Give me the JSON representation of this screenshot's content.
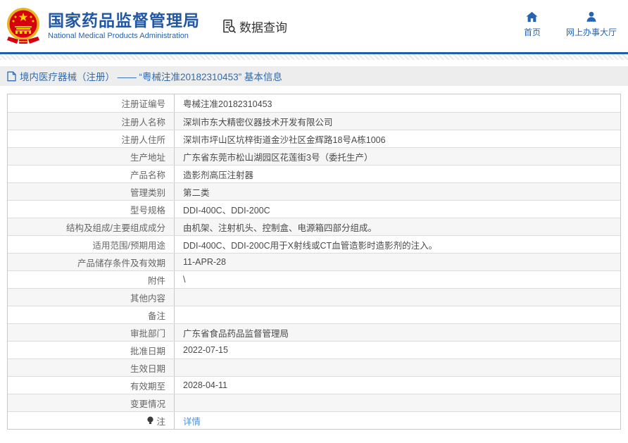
{
  "header": {
    "brand_title": "国家药品监督管理局",
    "brand_subtitle": "National Medical Products Administration",
    "data_query_label": "数据查询",
    "nav": [
      {
        "label": "首页",
        "icon": "home-icon"
      },
      {
        "label": "网上办事大厅",
        "icon": "person-icon"
      }
    ]
  },
  "page": {
    "title": "境内医疗器械（注册） —— “粤械注准20182310453” 基本信息"
  },
  "icons": {
    "emblem": "national-emblem-logo",
    "data_query": "document-search-icon",
    "page_title": "document-icon",
    "note": "bulb-icon"
  },
  "colors": {
    "brand_blue": "#2257a6",
    "nav_blue": "#2464b4",
    "divider_blue": "#1f60aa",
    "title_bar_bg": "#ededed",
    "link_blue": "#4a90d9",
    "zebra_gray": "#f6f6f6"
  },
  "table": {
    "rows": [
      {
        "label": "注册证编号",
        "value": "粤械注准20182310453"
      },
      {
        "label": "注册人名称",
        "value": "深圳市东大精密仪器技术开发有限公司"
      },
      {
        "label": "注册人住所",
        "value": "深圳市坪山区坑梓街道金沙社区金辉路18号A栋1006"
      },
      {
        "label": "生产地址",
        "value": "广东省东莞市松山湖园区花莲街3号（委托生产）"
      },
      {
        "label": "产品名称",
        "value": "造影剂高压注射器"
      },
      {
        "label": "管理类别",
        "value": "第二类"
      },
      {
        "label": "型号规格",
        "value": "DDI-400C、DDI-200C"
      },
      {
        "label": "结构及组成/主要组成成分",
        "value": "由机架、注射机头、控制盒、电源箱四部分组成。"
      },
      {
        "label": "适用范围/预期用途",
        "value": "DDI-400C、DDI-200C用于X射线或CT血管造影时造影剂的注入。"
      },
      {
        "label": "产品储存条件及有效期",
        "value": "11-APR-28"
      },
      {
        "label": "附件",
        "value": "\\"
      },
      {
        "label": "其他内容",
        "value": ""
      },
      {
        "label": "备注",
        "value": ""
      },
      {
        "label": "审批部门",
        "value": "广东省食品药品监督管理局"
      },
      {
        "label": "批准日期",
        "value": "2022-07-15"
      },
      {
        "label": "生效日期",
        "value": ""
      },
      {
        "label": "有效期至",
        "value": "2028-04-11"
      },
      {
        "label": "变更情况",
        "value": ""
      },
      {
        "label": "注",
        "value": "详情"
      }
    ]
  }
}
